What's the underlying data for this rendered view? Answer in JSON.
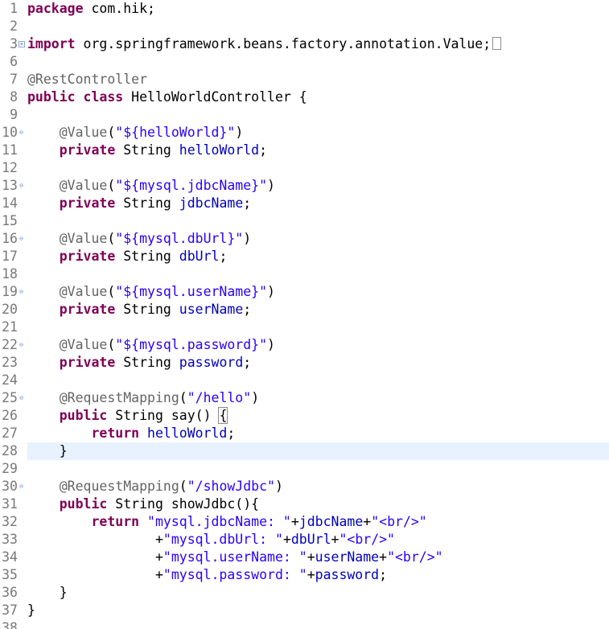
{
  "editor": {
    "current_line": 28,
    "lines": [
      {
        "n": "1",
        "code": "package com.hik;"
      },
      {
        "n": "2",
        "code": ""
      },
      {
        "n": "3",
        "code": "import org.springframework.beans.factory.annotation.Value;"
      },
      {
        "n": "6",
        "code": ""
      },
      {
        "n": "7",
        "code": "@RestController"
      },
      {
        "n": "8",
        "code": "public class HelloWorldController {"
      },
      {
        "n": "9",
        "code": ""
      },
      {
        "n": "10",
        "code": "    @Value(\"${helloWorld}\")"
      },
      {
        "n": "11",
        "code": "    private String helloWorld;"
      },
      {
        "n": "12",
        "code": ""
      },
      {
        "n": "13",
        "code": "    @Value(\"${mysql.jdbcName}\")"
      },
      {
        "n": "14",
        "code": "    private String jdbcName;"
      },
      {
        "n": "15",
        "code": ""
      },
      {
        "n": "16",
        "code": "    @Value(\"${mysql.dbUrl}\")"
      },
      {
        "n": "17",
        "code": "    private String dbUrl;"
      },
      {
        "n": "18",
        "code": ""
      },
      {
        "n": "19",
        "code": "    @Value(\"${mysql.userName}\")"
      },
      {
        "n": "20",
        "code": "    private String userName;"
      },
      {
        "n": "21",
        "code": ""
      },
      {
        "n": "22",
        "code": "    @Value(\"${mysql.password}\")"
      },
      {
        "n": "23",
        "code": "    private String password;"
      },
      {
        "n": "24",
        "code": ""
      },
      {
        "n": "25",
        "code": "    @RequestMapping(\"/hello\")"
      },
      {
        "n": "26",
        "code": "    public String say() {"
      },
      {
        "n": "27",
        "code": "        return helloWorld;"
      },
      {
        "n": "28",
        "code": "    }"
      },
      {
        "n": "29",
        "code": ""
      },
      {
        "n": "30",
        "code": "    @RequestMapping(\"/showJdbc\")"
      },
      {
        "n": "31",
        "code": "    public String showJdbc(){"
      },
      {
        "n": "32",
        "code": "        return \"mysql.jdbcName: \"+jdbcName+\"<br/>\""
      },
      {
        "n": "33",
        "code": "                +\"mysql.dbUrl: \"+dbUrl+\"<br/>\""
      },
      {
        "n": "34",
        "code": "                +\"mysql.userName: \"+userName+\"<br/>\""
      },
      {
        "n": "35",
        "code": "                +\"mysql.password: \"+password;"
      },
      {
        "n": "36",
        "code": "    }"
      },
      {
        "n": "37",
        "code": "}"
      },
      {
        "n": "38",
        "code": ""
      }
    ]
  },
  "colors": {
    "keyword": "#7f0055",
    "annotation": "#646464",
    "string": "#2a00ff",
    "field": "#0000c0",
    "current_line_bg": "#e8f2fe",
    "line_number": "#787878"
  }
}
